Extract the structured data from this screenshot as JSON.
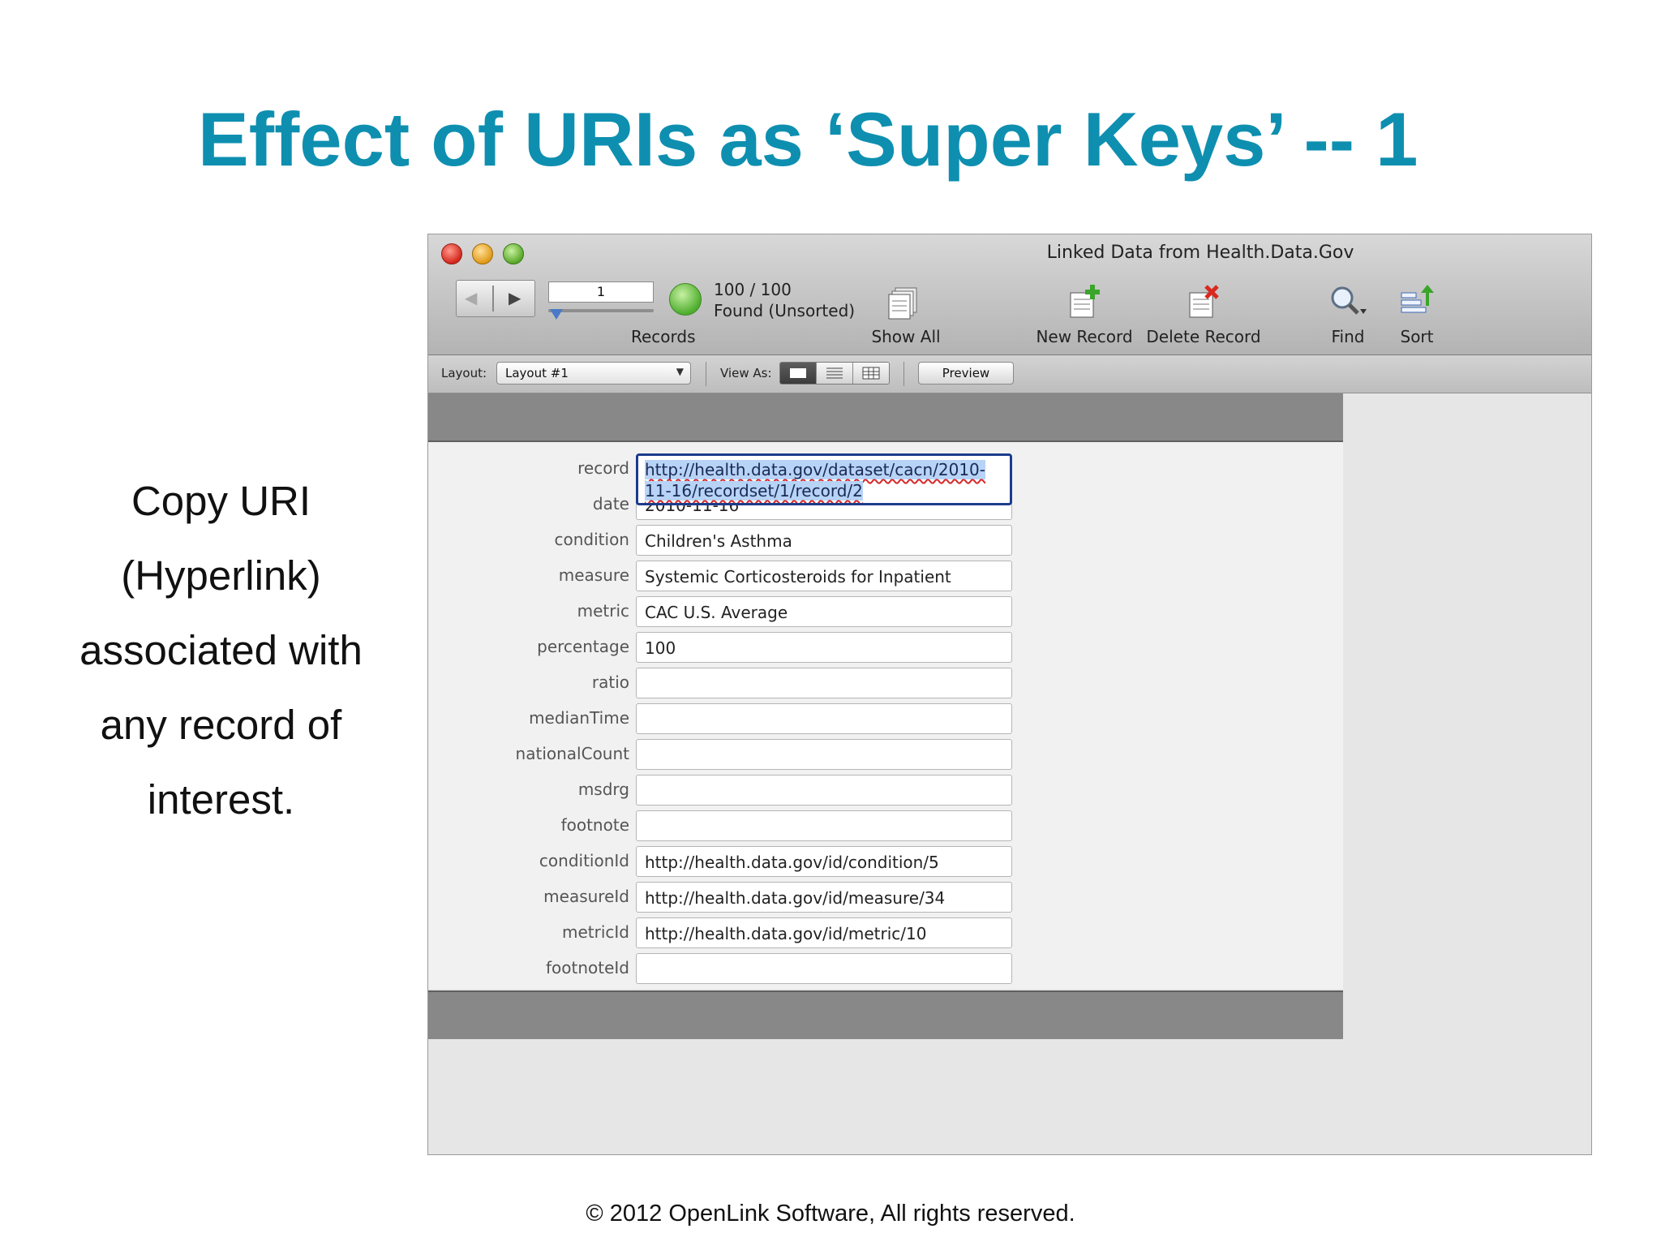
{
  "slide": {
    "title": "Effect of URIs as ‘Super Keys’ -- 1",
    "side_text_lines": [
      "Copy URI",
      "(Hyperlink)",
      "associated with",
      "any record of",
      "interest."
    ],
    "footer": "© 2012 OpenLink Software, All rights reserved."
  },
  "window": {
    "title": "Linked Data from Health.Data.Gov",
    "toolbar": {
      "record_number": "1",
      "found_count": "100 / 100",
      "found_status": "Found (Unsorted)",
      "records_label": "Records",
      "show_all_label": "Show All",
      "new_record_label": "New Record",
      "delete_record_label": "Delete Record",
      "find_label": "Find",
      "sort_label": "Sort"
    },
    "layout_bar": {
      "layout_label": "Layout:",
      "layout_value": "Layout #1",
      "view_as_label": "View As:",
      "preview_label": "Preview"
    },
    "fields": [
      {
        "label": "record",
        "value": "http://health.data.gov/dataset/cacn/2010-11-16/recordset/1/record/2"
      },
      {
        "label": "date",
        "value": "2010-11-16"
      },
      {
        "label": "condition",
        "value": "Children's Asthma"
      },
      {
        "label": "measure",
        "value": "Systemic Corticosteroids for Inpatient"
      },
      {
        "label": "metric",
        "value": "CAC U.S. Average"
      },
      {
        "label": "percentage",
        "value": "100"
      },
      {
        "label": "ratio",
        "value": ""
      },
      {
        "label": "medianTime",
        "value": ""
      },
      {
        "label": "nationalCount",
        "value": ""
      },
      {
        "label": "msdrg",
        "value": ""
      },
      {
        "label": "footnote",
        "value": ""
      },
      {
        "label": "conditionId",
        "value": "http://health.data.gov/id/condition/5"
      },
      {
        "label": "measureId",
        "value": "http://health.data.gov/id/measure/34"
      },
      {
        "label": "metricId",
        "value": "http://health.data.gov/id/metric/10"
      },
      {
        "label": "footnoteId",
        "value": ""
      }
    ]
  },
  "colors": {
    "title_accent": "#0e8fb0",
    "selection": "#b7d3f6",
    "active_field_border": "#1c3c8c"
  }
}
